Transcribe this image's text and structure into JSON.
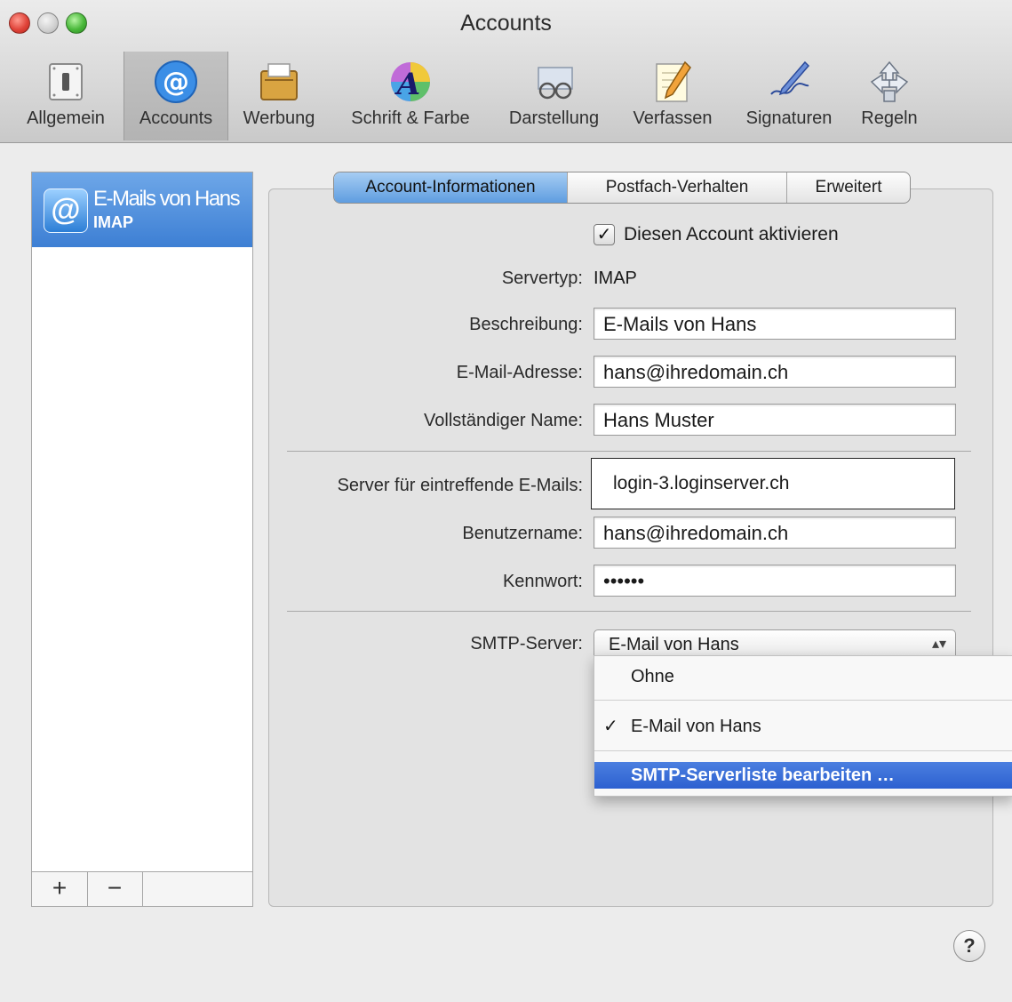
{
  "window": {
    "title": "Accounts",
    "accent": "#3d7fd4"
  },
  "toolbar": {
    "items": [
      {
        "label": "Allgemein",
        "icon": "switch-icon"
      },
      {
        "label": "Accounts",
        "icon": "at-sign-icon"
      },
      {
        "label": "Werbung",
        "icon": "mailbox-icon"
      },
      {
        "label": "Schrift & Farbe",
        "icon": "font-color-icon"
      },
      {
        "label": "Darstellung",
        "icon": "glasses-icon"
      },
      {
        "label": "Verfassen",
        "icon": "pencil-paper-icon"
      },
      {
        "label": "Signaturen",
        "icon": "pen-signature-icon"
      },
      {
        "label": "Regeln",
        "icon": "rules-arrows-icon"
      }
    ]
  },
  "sidebar": {
    "account": {
      "name": "E-Mails von Hans",
      "type": "IMAP"
    },
    "add_label": "+",
    "remove_label": "−"
  },
  "tabs": [
    "Account-Informationen",
    "Postfach-Verhalten",
    "Erweitert"
  ],
  "form": {
    "activate_label": "Diesen Account aktivieren",
    "servertyp_label": "Servertyp:",
    "servertyp_value": "IMAP",
    "beschreibung_label": "Beschreibung:",
    "beschreibung_value": "E-Mails von Hans",
    "email_label": "E-Mail-Adresse:",
    "email_value": "hans@ihredomain.ch",
    "name_label": "Vollständiger Name:",
    "name_value": "Hans Muster",
    "incoming_label": "Server für eintreffende E-Mails:",
    "incoming_value": "login-3.loginserver.ch",
    "user_label": "Benutzername:",
    "user_value": "hans@ihredomain.ch",
    "password_label": "Kennwort:",
    "password_value": "••••••",
    "smtp_label": "SMTP-Server:",
    "smtp_value": "E-Mail von Hans"
  },
  "smtp_menu": {
    "items": [
      "Ohne",
      "E-Mail von Hans",
      "SMTP-Serverliste bearbeiten …"
    ],
    "checkmark": "✓"
  },
  "help_label": "?"
}
